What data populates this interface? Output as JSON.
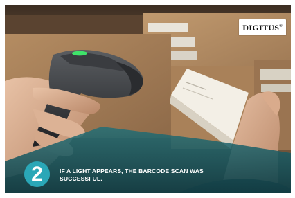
{
  "logo": {
    "text": "DIGITUS",
    "mark": "®"
  },
  "step": {
    "number": "2"
  },
  "caption": {
    "line1": "IF A LIGHT APPEARS, THE BARCODE SCAN WAS",
    "line2": "SUCCESSFUL."
  },
  "colors": {
    "accent": "#2aa7b7",
    "overlay": "#1f6f78",
    "scanner_light": "#3fe36a"
  }
}
